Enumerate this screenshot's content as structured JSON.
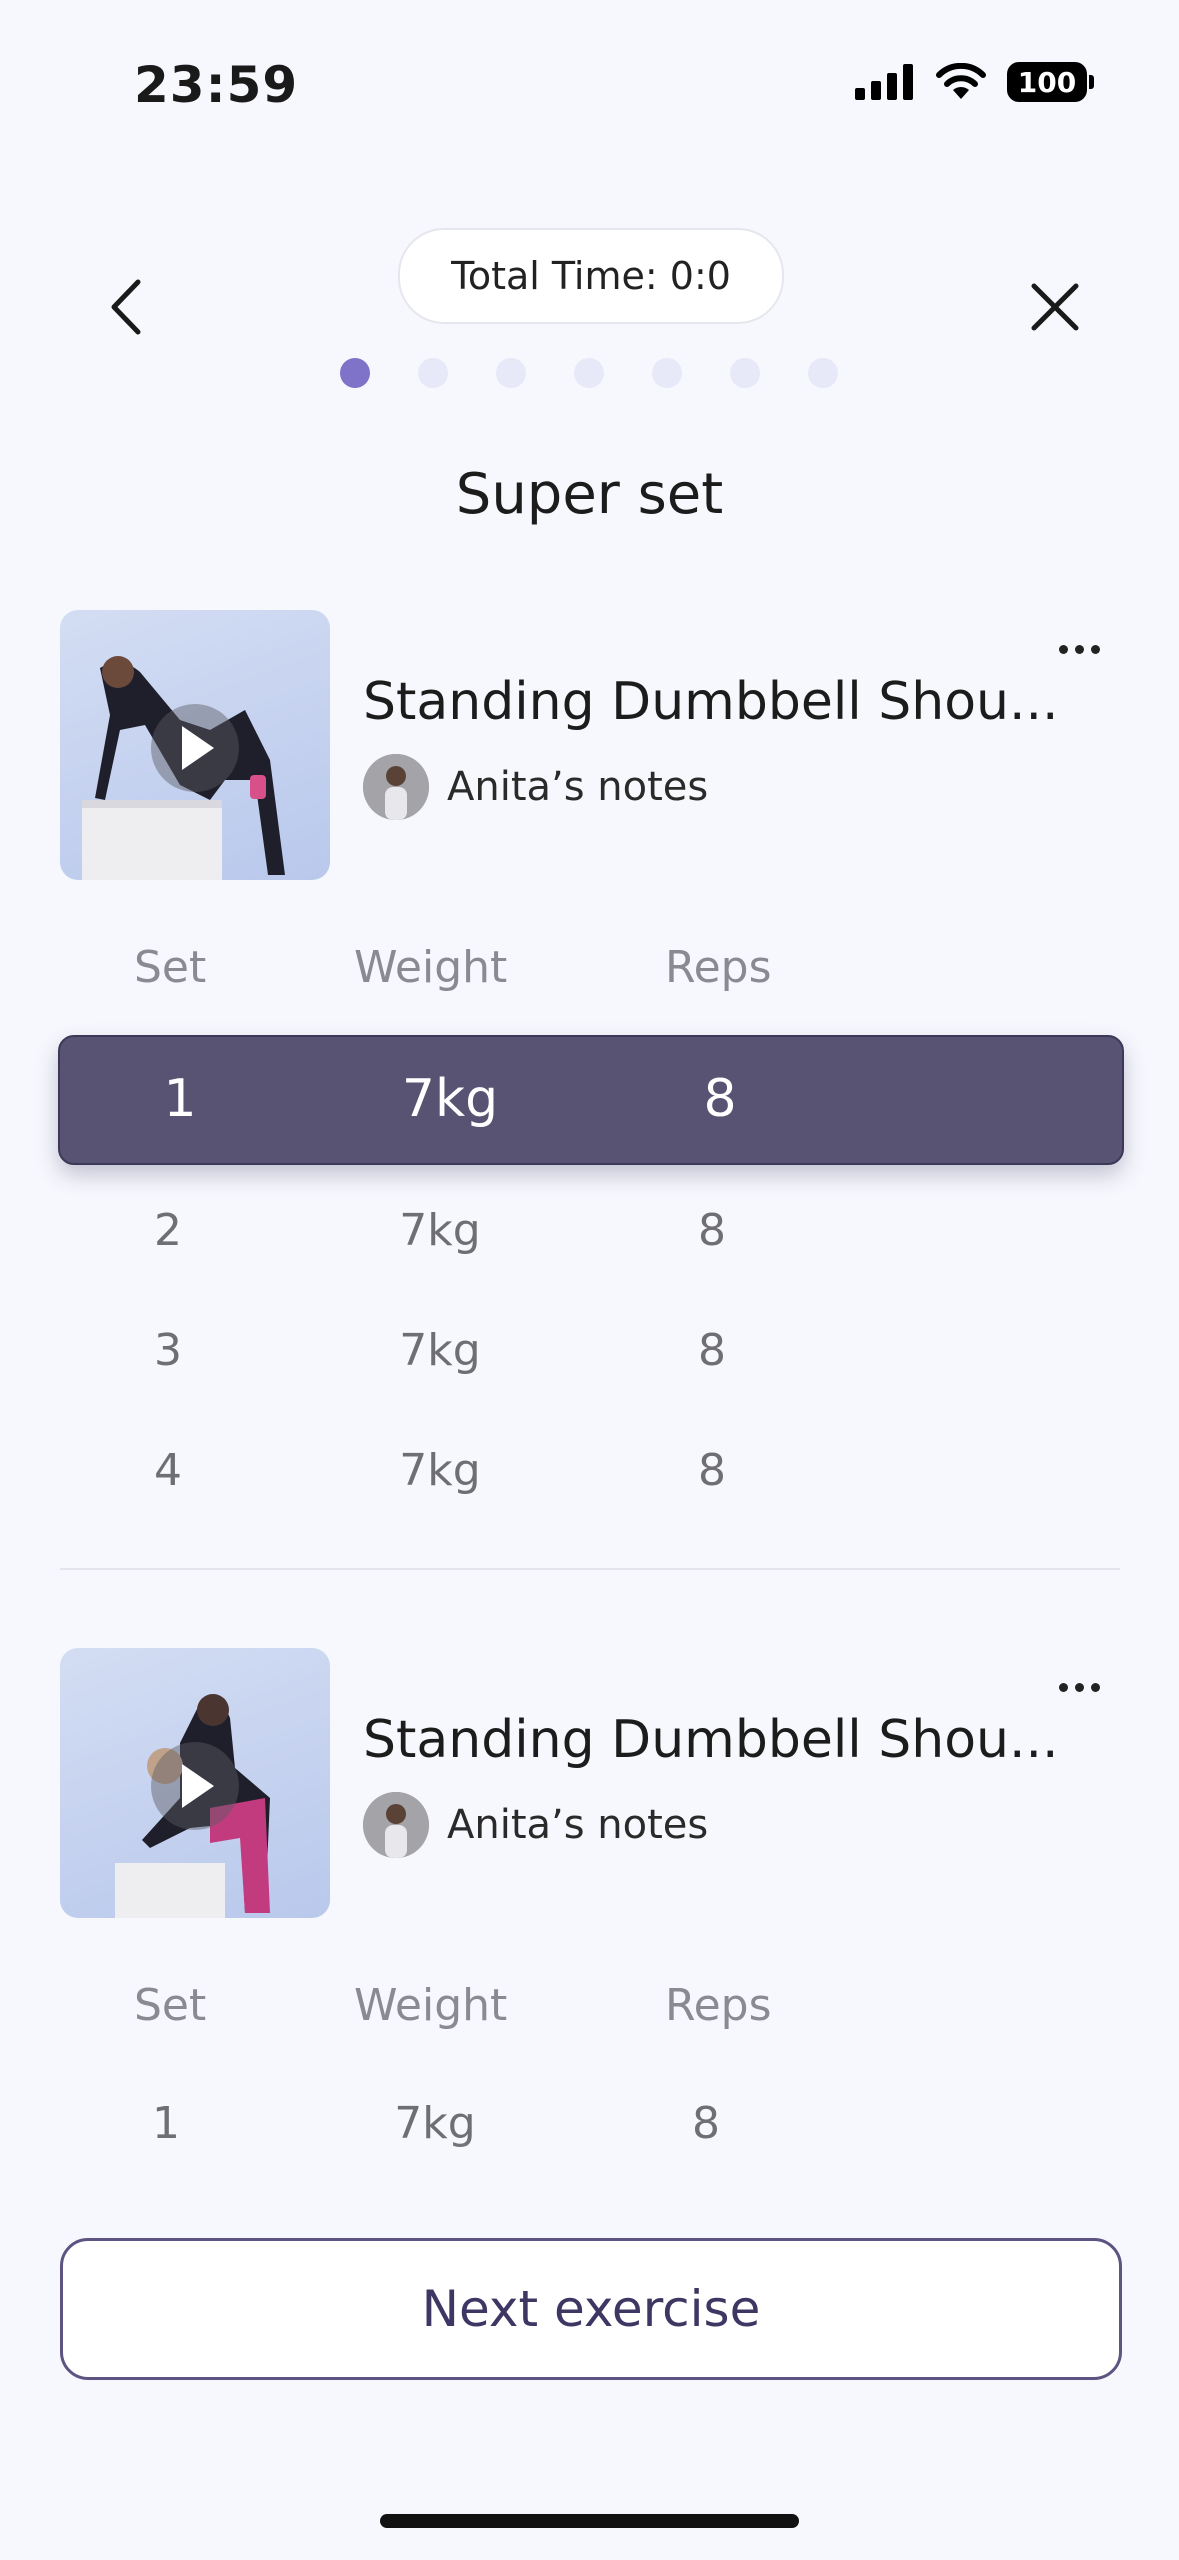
{
  "status_bar": {
    "time": "23:59",
    "battery": "100"
  },
  "header": {
    "total_time_label": "Total Time:",
    "total_time_value": "0:0"
  },
  "progress": {
    "total": 7,
    "current": 1
  },
  "page_title": "Super set",
  "table_headers": {
    "set": "Set",
    "weight": "Weight",
    "reps": "Reps"
  },
  "exercises": [
    {
      "title": "Standing Dumbbell Shou...",
      "notes_label": "Anita’s notes",
      "sets": [
        {
          "set": "1",
          "weight": "7kg",
          "reps": "8"
        },
        {
          "set": "2",
          "weight": "7kg",
          "reps": "8"
        },
        {
          "set": "3",
          "weight": "7kg",
          "reps": "8"
        },
        {
          "set": "4",
          "weight": "7kg",
          "reps": "8"
        }
      ]
    },
    {
      "title": "Standing Dumbbell Shou...",
      "notes_label": "Anita’s notes",
      "sets": [
        {
          "set": "1",
          "weight": "7kg",
          "reps": "8"
        }
      ]
    }
  ],
  "next_button": "Next exercise",
  "colors": {
    "accent": "#7e72c9",
    "active_row": "#585373",
    "button_text": "#3e3763"
  }
}
